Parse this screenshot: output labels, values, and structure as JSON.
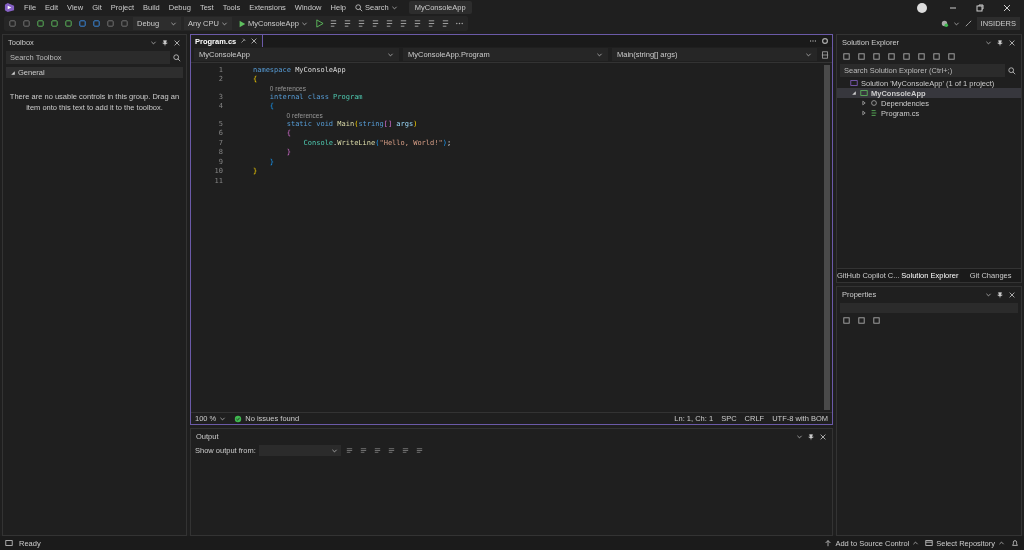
{
  "menu": {
    "items": [
      "File",
      "Edit",
      "View",
      "Git",
      "Project",
      "Build",
      "Debug",
      "Test",
      "Tools",
      "Extensions",
      "Window",
      "Help"
    ],
    "search": "Search",
    "solution_badge": "MyConsoleApp"
  },
  "toolbar": {
    "configuration": "Debug",
    "platform": "Any CPU",
    "start": "MyConsoleApp",
    "channel": "INSIDERS"
  },
  "toolbox": {
    "title": "Toolbox",
    "search": {
      "placeholder": "Search Toolbox"
    },
    "group": {
      "label": "General",
      "expanded": true
    },
    "message": "There are no usable controls in this group. Drag an item onto this text to add it to the toolbox."
  },
  "editor": {
    "tabs": [
      {
        "label": "Program.cs",
        "selected": true
      }
    ],
    "nav": [
      "MyConsoleApp",
      "MyConsoleApp.Program",
      "Main(string[] args)"
    ],
    "lines": [
      {
        "number": "1",
        "tokens": [
          {
            "text": "namespace",
            "kind": "kw"
          },
          {
            "text": " MyConsoleApp",
            "kind": "plain"
          }
        ]
      },
      {
        "number": "2",
        "tokens": [
          {
            "text": "{",
            "kind": "b1"
          }
        ]
      },
      {
        "number": "3",
        "lens": "0 references",
        "tokens": [
          {
            "text": "    internal class",
            "kind": "kw"
          },
          {
            "text": " Program",
            "kind": "type"
          }
        ]
      },
      {
        "number": "4",
        "tokens": [
          {
            "text": "    {",
            "kind": "b3"
          }
        ]
      },
      {
        "number": "5",
        "lens": "0 references",
        "tokens": [
          {
            "text": "        static void",
            "kind": "kw"
          },
          {
            "text": " Main",
            "kind": "method"
          },
          {
            "text": "(",
            "kind": "b1"
          },
          {
            "text": "string",
            "kind": "kw"
          },
          {
            "text": "[]",
            "kind": "b2"
          },
          {
            "text": " args",
            "kind": "param"
          },
          {
            "text": ")",
            "kind": "b1"
          }
        ]
      },
      {
        "number": "6",
        "tokens": [
          {
            "text": "        {",
            "kind": "b2"
          }
        ]
      },
      {
        "number": "7",
        "tokens": [
          {
            "text": "            Console",
            "kind": "type"
          },
          {
            "text": ".",
            "kind": "plain"
          },
          {
            "text": "WriteLine",
            "kind": "method"
          },
          {
            "text": "(",
            "kind": "b3"
          },
          {
            "text": "\"Hello, World!\"",
            "kind": "str"
          },
          {
            "text": ")",
            "kind": "b3"
          },
          {
            "text": ";",
            "kind": "plain"
          }
        ]
      },
      {
        "number": "8",
        "tokens": [
          {
            "text": "        }",
            "kind": "b2"
          }
        ]
      },
      {
        "number": "9",
        "tokens": [
          {
            "text": "    }",
            "kind": "b3"
          }
        ]
      },
      {
        "number": "10",
        "tokens": [
          {
            "text": "}",
            "kind": "b1"
          }
        ]
      },
      {
        "number": "11"
      }
    ],
    "status": {
      "zoom": "100 %",
      "issues": "No issues found",
      "position": "Ln: 1, Ch: 1",
      "indent": "SPC",
      "line_ending": "CRLF",
      "encoding": "UTF-8 with BOM"
    }
  },
  "output": {
    "title": "Output",
    "label": "Show output from:"
  },
  "solution_explorer": {
    "title": "Solution Explorer",
    "search": {
      "placeholder": "Search Solution Explorer (Ctrl+;)"
    },
    "tree": [
      {
        "label": "Solution 'MyConsoleApp' (1 of 1 project)",
        "kind": "solution",
        "selected": false,
        "children": [
          {
            "label": "MyConsoleApp",
            "kind": "project",
            "expanded": true,
            "selected": true,
            "children": [
              {
                "label": "Dependencies",
                "kind": "deps",
                "expanded": false,
                "selected": false
              },
              {
                "label": "Program.cs",
                "kind": "file",
                "expanded": false,
                "selected": false
              }
            ]
          }
        ]
      }
    ],
    "tabs": [
      {
        "label": "GitHub Copilot C...",
        "selected": false
      },
      {
        "label": "Solution Explorer",
        "selected": true
      },
      {
        "label": "Git Changes",
        "selected": false
      }
    ]
  },
  "properties": {
    "title": "Properties"
  },
  "status_bar": {
    "text": "Ready",
    "source_control": "Add to Source Control",
    "repository": "Select Repository"
  }
}
